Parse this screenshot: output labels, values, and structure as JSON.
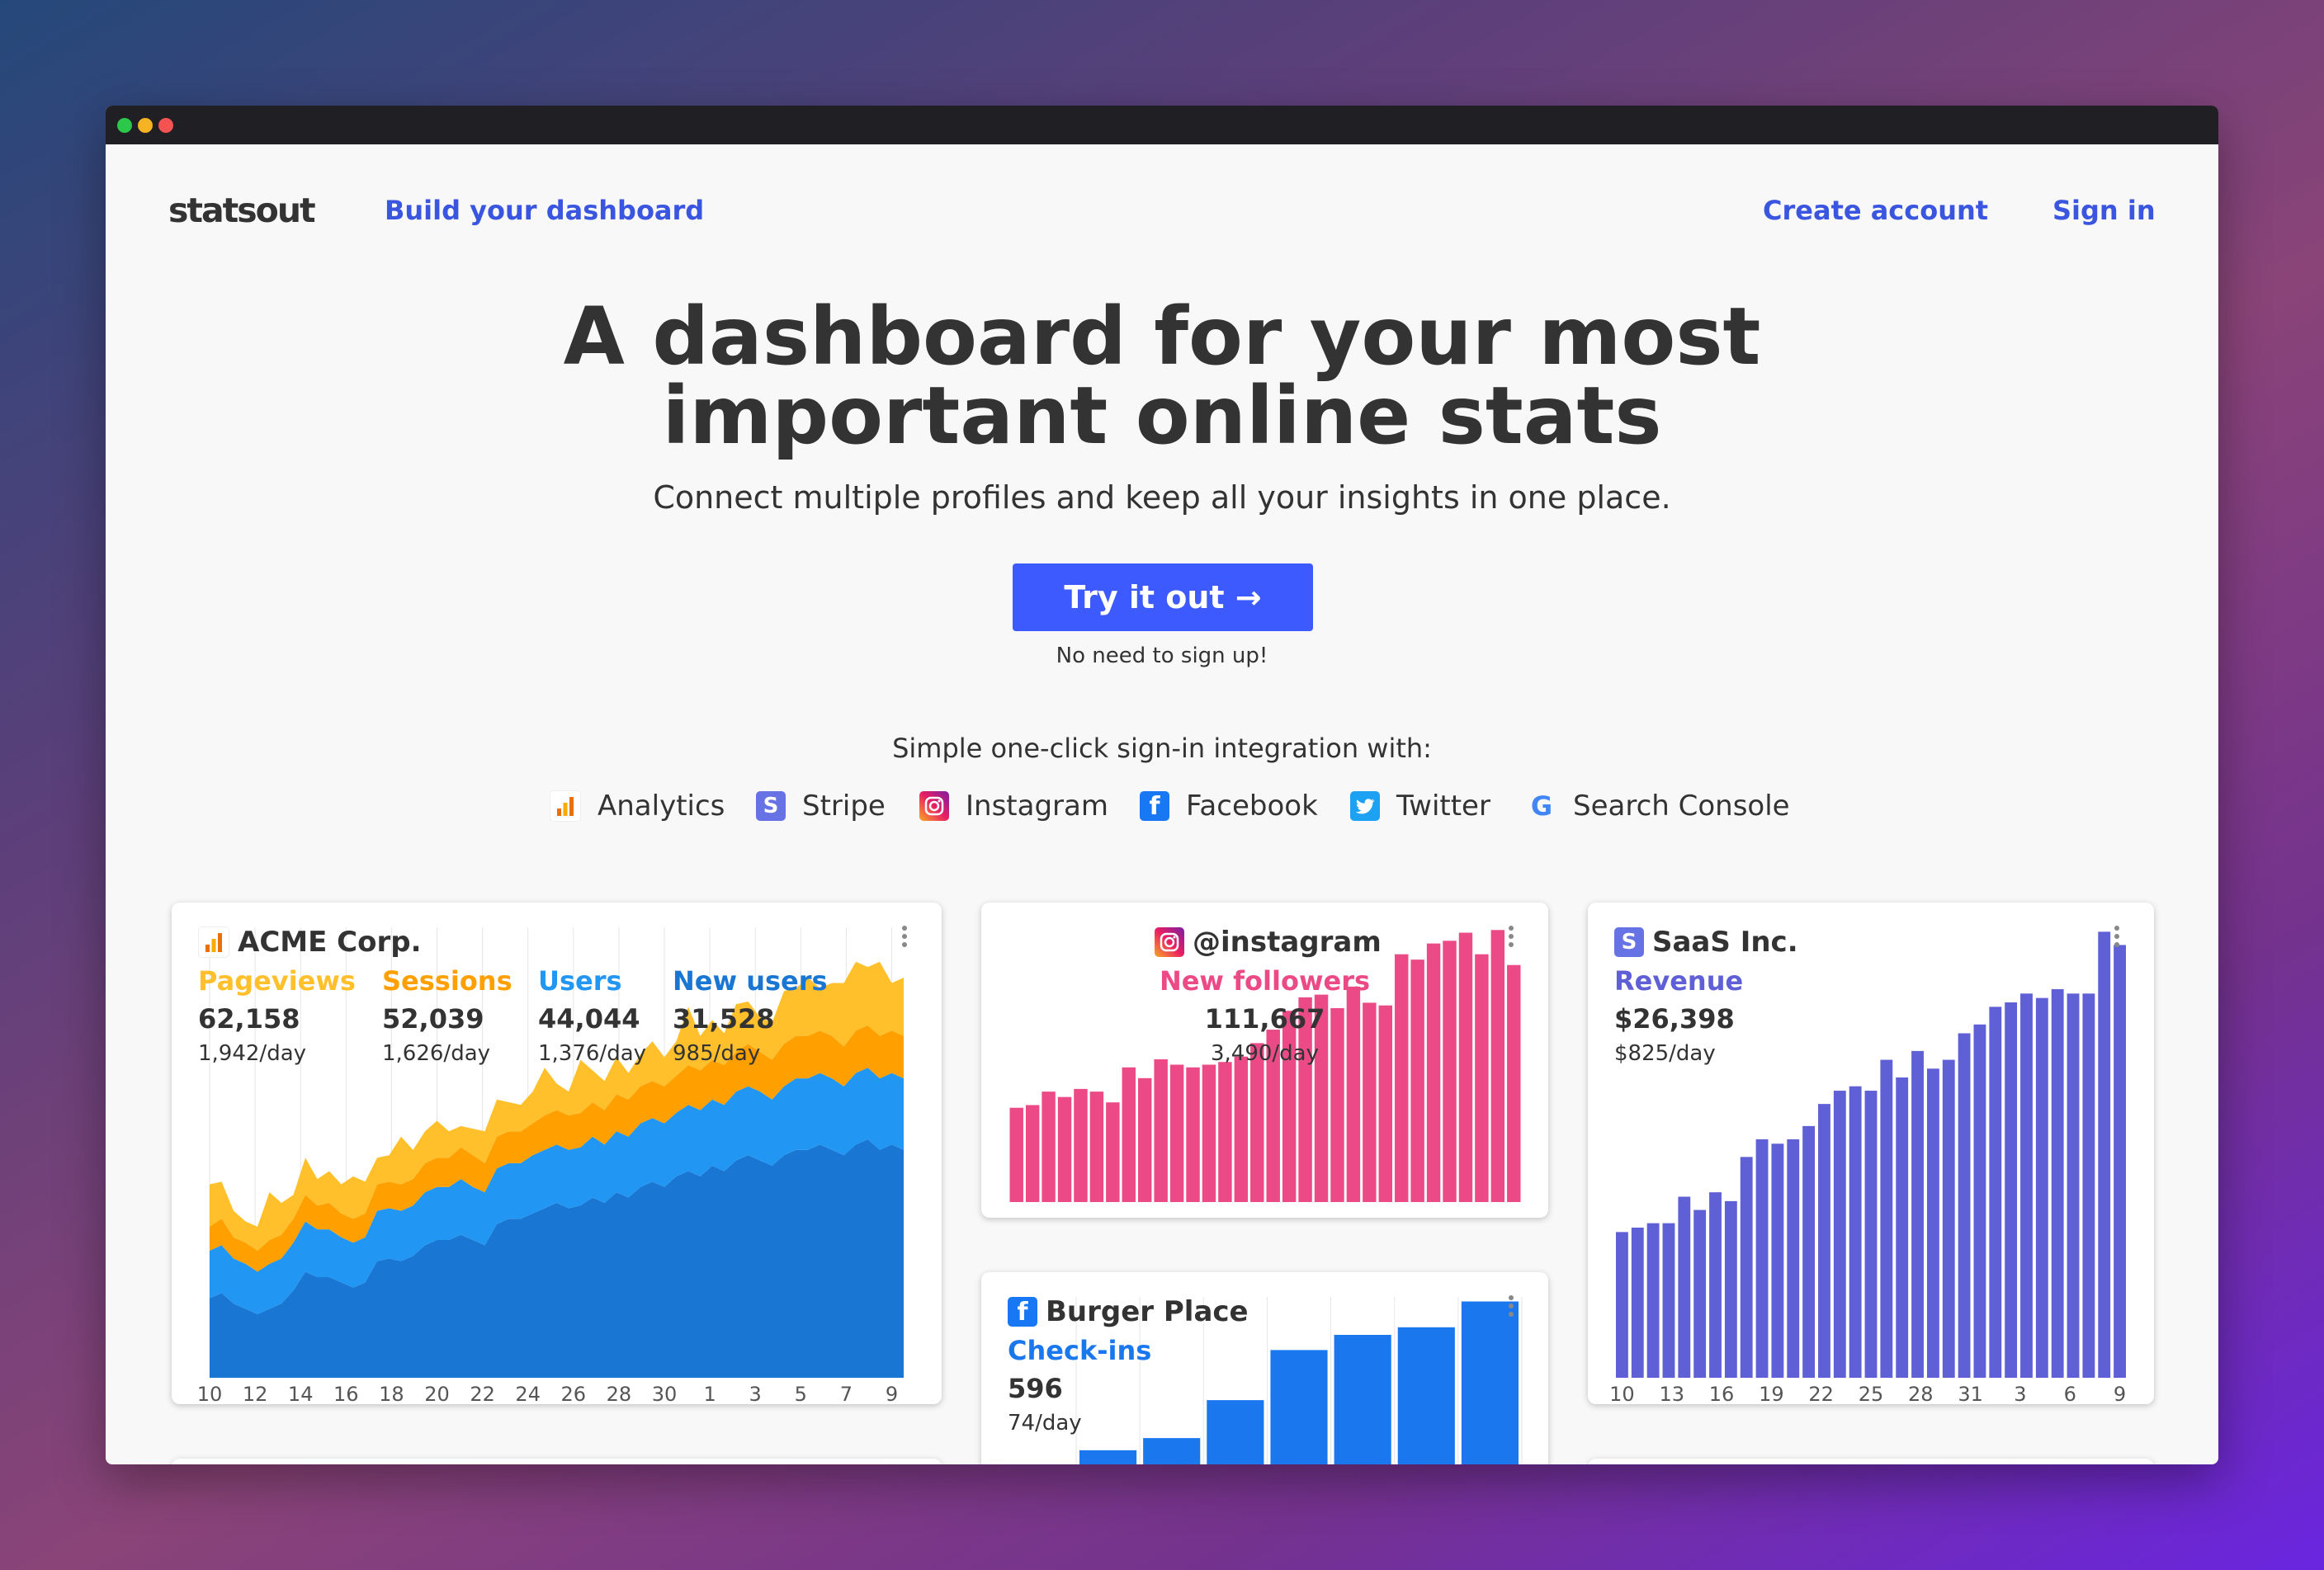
{
  "nav": {
    "logo": "statsout",
    "build": "Build your dashboard",
    "create": "Create account",
    "signin": "Sign in"
  },
  "hero": {
    "title_line1": "A dashboard for your most",
    "title_line2": "important online stats",
    "subtitle": "Connect multiple profiles and keep all your insights in one place.",
    "cta": "Try it out →",
    "note": "No need to sign up!"
  },
  "integrations": {
    "title": "Simple one-click sign-in integration with:",
    "items": [
      {
        "label": "Analytics",
        "icon": "analytics-icon"
      },
      {
        "label": "Stripe",
        "icon": "stripe-icon",
        "glyph": "S"
      },
      {
        "label": "Instagram",
        "icon": "instagram-icon"
      },
      {
        "label": "Facebook",
        "icon": "facebook-icon",
        "glyph": "f"
      },
      {
        "label": "Twitter",
        "icon": "twitter-icon"
      },
      {
        "label": "Search Console",
        "icon": "google-icon",
        "glyph": "G"
      }
    ]
  },
  "cards": {
    "acme": {
      "title": "ACME Corp.",
      "metrics": [
        {
          "label": "Pageviews",
          "value": "62,158",
          "rate": "1,942/day",
          "color": "#ffc02b"
        },
        {
          "label": "Sessions",
          "value": "52,039",
          "rate": "1,626/day",
          "color": "#ffa000"
        },
        {
          "label": "Users",
          "value": "44,044",
          "rate": "1,376/day",
          "color": "#2196f3"
        },
        {
          "label": "New users",
          "value": "31,528",
          "rate": "985/day",
          "color": "#1976d2"
        }
      ]
    },
    "instagram": {
      "title": "@instagram",
      "metric": {
        "label": "New followers",
        "value": "111,667",
        "rate": "3,490/day",
        "color": "#ec4a86"
      }
    },
    "saas": {
      "title": "SaaS Inc.",
      "metric": {
        "label": "Revenue",
        "value": "$26,398",
        "rate": "$825/day",
        "color": "#5f5fd6"
      }
    },
    "burger": {
      "title": "Burger Place",
      "metric": {
        "label": "Check-ins",
        "value": "596",
        "rate": "74/day",
        "color": "#1a77ee"
      }
    }
  },
  "chart_data": [
    {
      "type": "area",
      "stacked": true,
      "x_ticks": [
        "10",
        "12",
        "14",
        "16",
        "18",
        "20",
        "22",
        "24",
        "26",
        "28",
        "30",
        "1",
        "3",
        "5",
        "7",
        "9"
      ],
      "series": [
        {
          "name": "New users",
          "color": "#1976d2",
          "values": [
            30,
            32,
            28,
            26,
            24,
            26,
            28,
            33,
            40,
            38,
            38,
            36,
            34,
            36,
            44,
            45,
            44,
            46,
            50,
            52,
            52,
            54,
            52,
            50,
            58,
            60,
            60,
            62,
            64,
            66,
            64,
            65,
            68,
            66,
            70,
            68,
            72,
            74,
            72,
            76,
            78,
            76,
            80,
            78,
            82,
            84,
            82,
            80,
            84,
            86,
            86,
            88,
            86,
            84,
            88,
            90,
            86,
            88,
            86
          ]
        },
        {
          "name": "Users",
          "color": "#2196f3",
          "values": [
            18,
            18,
            17,
            17,
            16,
            17,
            17,
            18,
            19,
            18,
            18,
            17,
            17,
            17,
            19,
            19,
            19,
            19,
            20,
            20,
            20,
            21,
            20,
            20,
            21,
            21,
            21,
            22,
            22,
            22,
            22,
            22,
            23,
            22,
            23,
            23,
            24,
            24,
            24,
            24,
            25,
            25,
            25,
            25,
            26,
            26,
            26,
            25,
            26,
            27,
            27,
            27,
            27,
            26,
            27,
            27,
            27,
            27,
            27
          ]
        },
        {
          "name": "Sessions",
          "color": "#ffa000",
          "values": [
            9,
            10,
            8,
            8,
            8,
            9,
            9,
            9,
            10,
            9,
            10,
            9,
            9,
            9,
            10,
            10,
            10,
            10,
            11,
            11,
            11,
            12,
            12,
            11,
            12,
            12,
            12,
            12,
            13,
            13,
            13,
            13,
            13,
            13,
            14,
            14,
            14,
            14,
            14,
            14,
            15,
            15,
            15,
            15,
            15,
            16,
            15,
            15,
            16,
            16,
            16,
            16,
            16,
            15,
            16,
            16,
            16,
            16,
            16
          ]
        },
        {
          "name": "Pageviews",
          "color": "#ffc02b",
          "values": [
            16,
            14,
            10,
            8,
            9,
            18,
            12,
            9,
            14,
            10,
            12,
            11,
            16,
            12,
            10,
            10,
            18,
            11,
            12,
            14,
            10,
            8,
            10,
            12,
            14,
            11,
            10,
            12,
            18,
            10,
            9,
            20,
            12,
            11,
            14,
            10,
            12,
            15,
            11,
            13,
            22,
            13,
            15,
            12,
            18,
            16,
            13,
            14,
            20,
            18,
            22,
            16,
            20,
            24,
            26,
            22,
            28,
            18,
            22
          ]
        }
      ]
    },
    {
      "type": "bar",
      "series": [
        {
          "name": "New followers",
          "color": "#ec4a86",
          "values": [
            35,
            36,
            41,
            39,
            42,
            41,
            37,
            50,
            46,
            53,
            51,
            50,
            51,
            52,
            54,
            59,
            64,
            71,
            76,
            77,
            72,
            80,
            74,
            73,
            92,
            90,
            96,
            97,
            100,
            92,
            101,
            88
          ]
        }
      ]
    },
    {
      "type": "bar",
      "x_ticks": [
        "10",
        "13",
        "16",
        "19",
        "22",
        "25",
        "28",
        "31",
        "3",
        "6",
        "9"
      ],
      "series": [
        {
          "name": "Revenue",
          "color": "#5f5fd6",
          "values": [
            33,
            34,
            35,
            35,
            41,
            38,
            42,
            40,
            50,
            54,
            53,
            54,
            57,
            62,
            65,
            66,
            65,
            72,
            68,
            74,
            70,
            72,
            78,
            80,
            84,
            85,
            87,
            86,
            88,
            87,
            87,
            101,
            98
          ]
        }
      ]
    },
    {
      "type": "bar",
      "series": [
        {
          "name": "Check-ins",
          "color": "#1a77ee",
          "values": [
            24,
            32,
            57,
            90,
            100,
            105,
            122
          ]
        }
      ]
    }
  ]
}
